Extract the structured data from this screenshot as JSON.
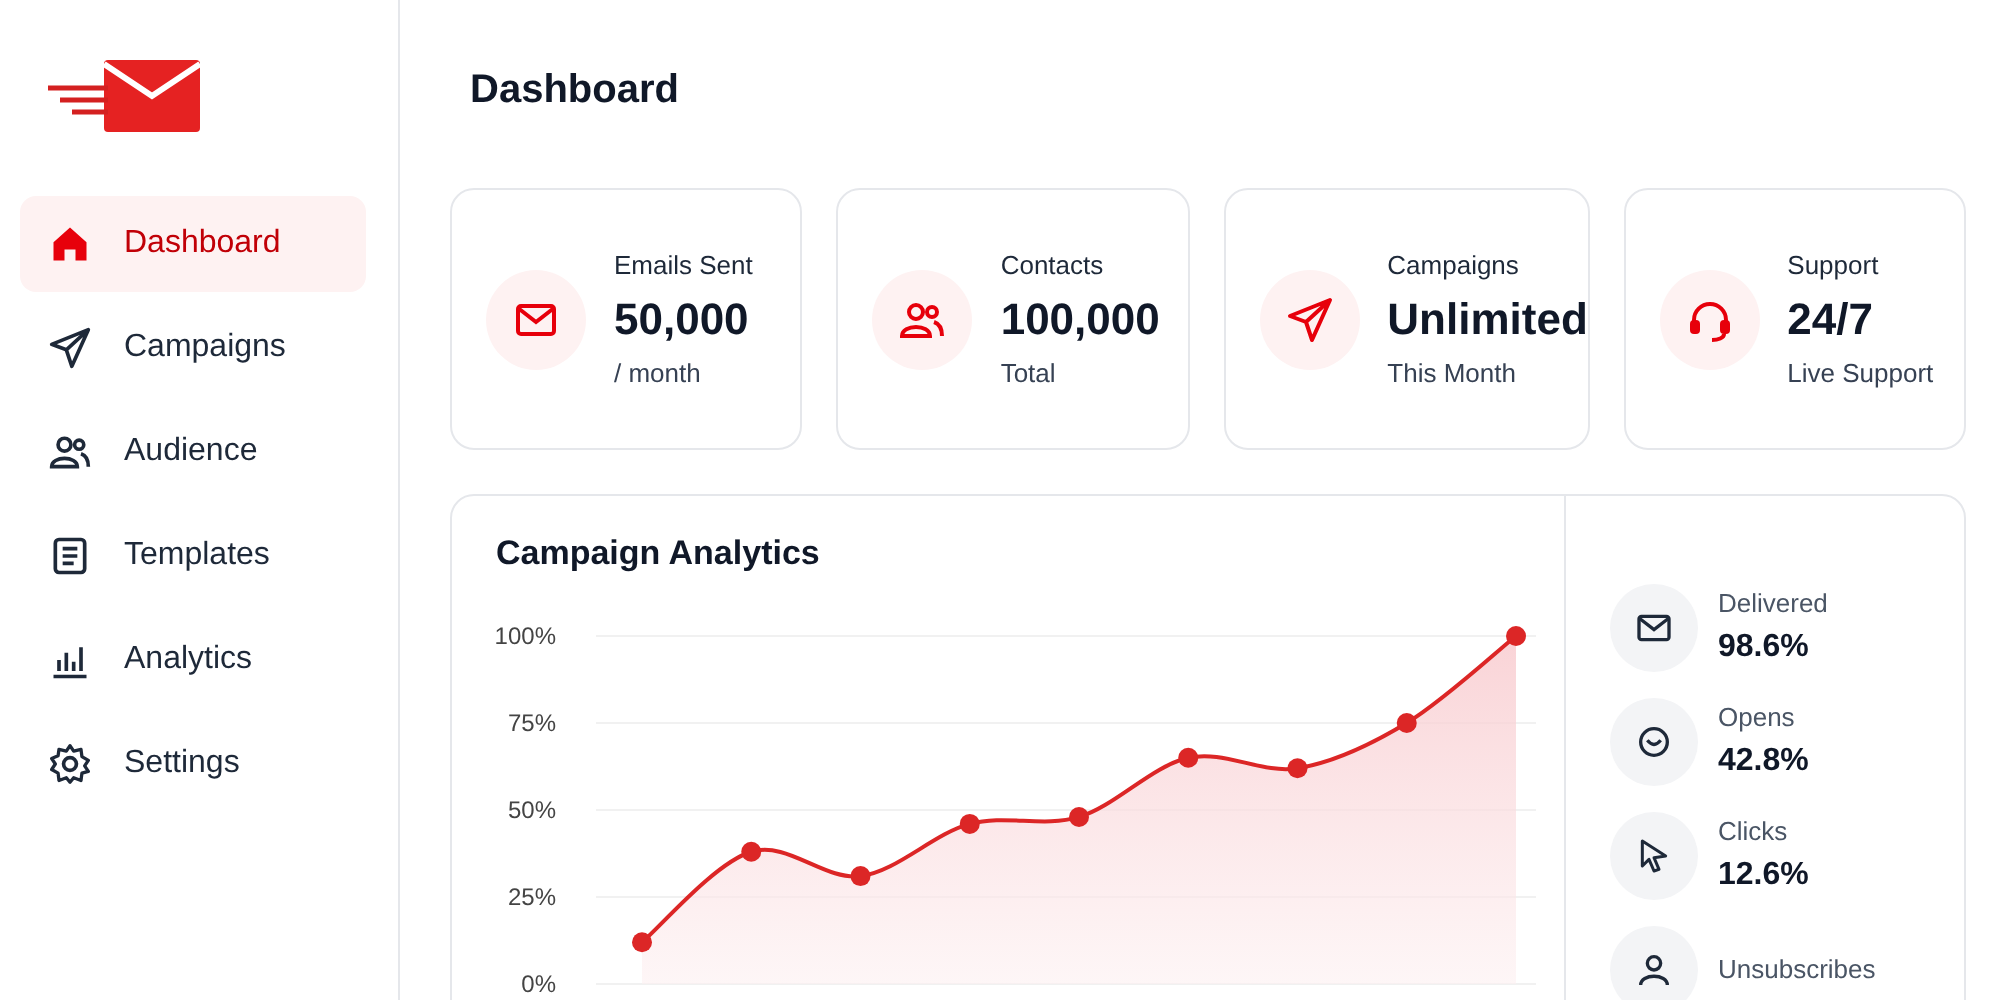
{
  "sidebar": {
    "items": [
      {
        "label": "Dashboard",
        "selected": true
      },
      {
        "label": "Campaigns",
        "selected": false
      },
      {
        "label": "Audience",
        "selected": false
      },
      {
        "label": "Templates",
        "selected": false
      },
      {
        "label": "Analytics",
        "selected": false
      },
      {
        "label": "Settings",
        "selected": false
      }
    ]
  },
  "page_title": "Dashboard",
  "stat_cards": [
    {
      "label": "Emails Sent",
      "value": "50,000",
      "caption": "/ month"
    },
    {
      "label": "Contacts",
      "value": "100,000",
      "caption": "Total"
    },
    {
      "label": "Campaigns",
      "value": "Unlimited",
      "caption": "This Month"
    },
    {
      "label": "Support",
      "value": "24/7",
      "caption": "Live Support"
    }
  ],
  "analytics": {
    "title": "Campaign Analytics",
    "chart_data": {
      "type": "area",
      "grid": true,
      "ylim": [
        0,
        100
      ],
      "yticks": [
        {
          "value": 0,
          "label": "0%"
        },
        {
          "value": 25,
          "label": "25%"
        },
        {
          "value": 50,
          "label": "50%"
        },
        {
          "value": 75,
          "label": "75%"
        },
        {
          "value": 100,
          "label": "100%"
        }
      ],
      "series": [
        {
          "color": "#dc2626",
          "values": [
            12,
            38,
            31,
            46,
            48,
            65,
            62,
            75,
            100
          ]
        }
      ]
    },
    "metrics": [
      {
        "label": "Delivered",
        "value": "98.6%"
      },
      {
        "label": "Opens",
        "value": "42.8%"
      },
      {
        "label": "Clicks",
        "value": "12.6%"
      },
      {
        "label": "Unsubscribes"
      }
    ]
  }
}
